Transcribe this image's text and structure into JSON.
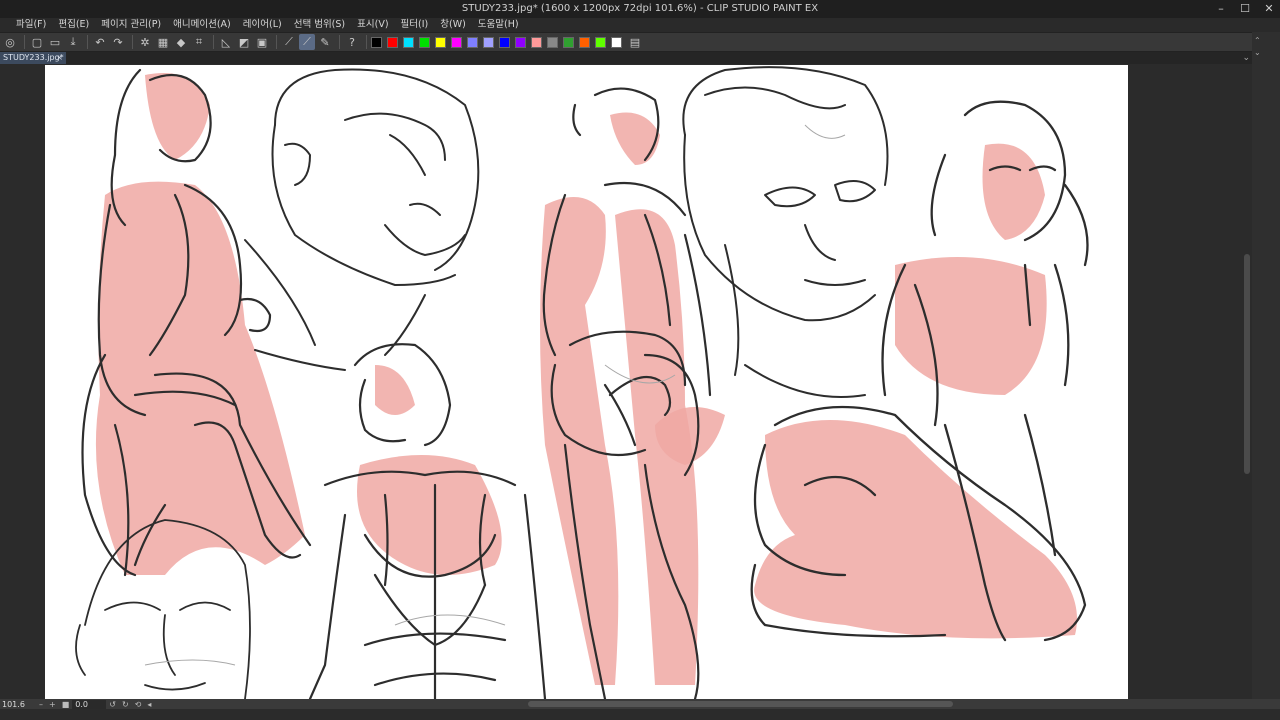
{
  "window": {
    "title": "STUDY233.jpg* (1600 x 1200px 72dpi 101.6%)  - CLIP STUDIO PAINT EX"
  },
  "menu": [
    {
      "label": "파일(F)"
    },
    {
      "label": "편집(E)"
    },
    {
      "label": "페이지 관리(P)"
    },
    {
      "label": "애니메이션(A)"
    },
    {
      "label": "레이어(L)"
    },
    {
      "label": "선택 범위(S)"
    },
    {
      "label": "표시(V)"
    },
    {
      "label": "필터(I)"
    },
    {
      "label": "창(W)"
    },
    {
      "label": "도움말(H)"
    }
  ],
  "toolbar": {
    "icons": [
      "clip-studio-icon",
      "new-file-icon",
      "open-file-icon",
      "save-icon",
      "undo-icon",
      "redo-icon",
      "transform-icon",
      "fill-icon",
      "crop-icon",
      "ruler-icon",
      "snap-icon",
      "pen-icon",
      "brush-icon",
      "help-icon"
    ],
    "colors": [
      "#000000",
      "#ff0000",
      "#00e0ff",
      "#00e000",
      "#ffff00",
      "#ff00ff",
      "#7f7fff",
      "#a0a0ff",
      "#0000ff",
      "#9000ff",
      "#ff9a9a",
      "#888888",
      "#30a030",
      "#ff6000",
      "#60ff00",
      "#ffffff"
    ]
  },
  "tab": {
    "label": "STUDY233.jpg*",
    "close": "×"
  },
  "status": {
    "zoom": "101.6",
    "rotation": "0.0"
  }
}
